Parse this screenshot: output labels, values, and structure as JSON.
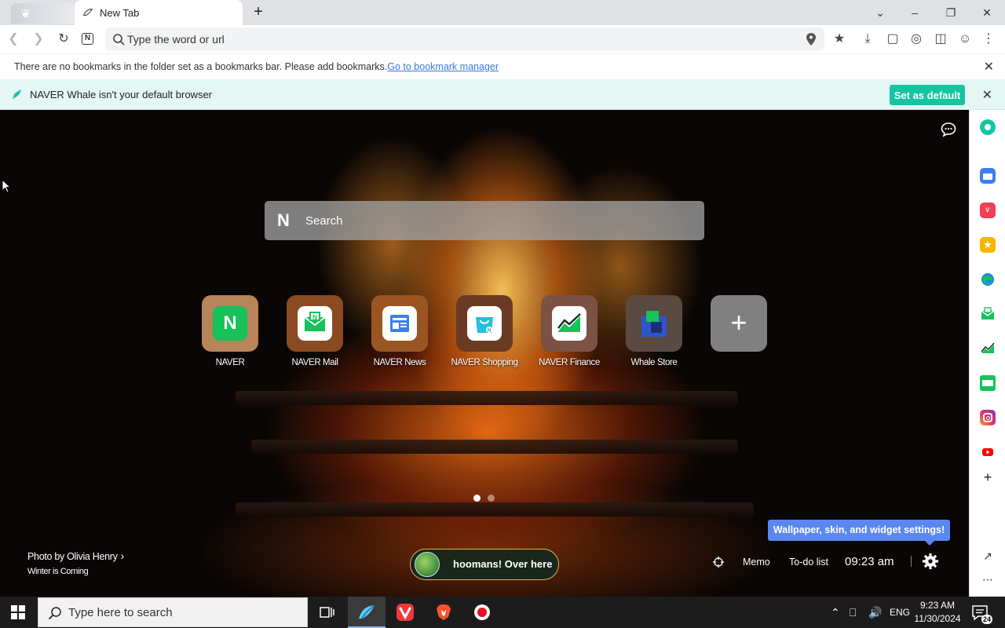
{
  "browser": {
    "tabs": [
      {
        "title": "New Tab",
        "active": true
      }
    ],
    "omnibox_placeholder": "Type the word or url",
    "nav_badge": "N",
    "bookmark_notice": {
      "text": "There are no bookmarks in the folder set as a bookmarks bar. Please add bookmarks.",
      "link": "Go to bookmark manager"
    },
    "infobar": {
      "text": "NAVER Whale isn't your default browser",
      "button": "Set as default"
    }
  },
  "ntp": {
    "search_logo": "N",
    "search_placeholder": "Search",
    "tiles": [
      {
        "label": "NAVER",
        "icon": "naver-icon",
        "bg": "#b8845a",
        "inner": "#16c25a"
      },
      {
        "label": "NAVER Mail",
        "icon": "naver-mail-icon",
        "bg": "#8a4a22",
        "inner": "#ffffff"
      },
      {
        "label": "NAVER News",
        "icon": "naver-news-icon",
        "bg": "#9a5523",
        "inner": "#ffffff"
      },
      {
        "label": "NAVER Shopping",
        "icon": "naver-shopping-icon",
        "bg": "#6a3b22",
        "inner": "#ffffff"
      },
      {
        "label": "NAVER Finance",
        "icon": "naver-finance-icon",
        "bg": "#7b5243",
        "inner": "#ffffff"
      },
      {
        "label": "Whale Store",
        "icon": "whale-store-icon",
        "bg": "#5b4a42",
        "inner": "#2f56c8"
      }
    ],
    "photo_credit": {
      "name": "Photo by Olivia Henry",
      "title": "Winter is Coming"
    },
    "hoomans": "hoomans! Over here",
    "widget_tooltip": "Wallpaper, skin, and widget settings!",
    "memo": "Memo",
    "todo": "To-do list",
    "clock": "09:23 am"
  },
  "sidebar_items": [
    "green-dot-icon",
    "calendar-icon",
    "pocket-icon",
    "star-icon",
    "edge-icon",
    "naver-mail-icon",
    "finance-icon",
    "webtoon-icon",
    "instagram-icon",
    "youtube-icon",
    "add-icon"
  ],
  "taskbar": {
    "search_placeholder": "Type here to search",
    "lang": "ENG",
    "time": "9:23 AM",
    "date": "11/30/2024",
    "notification_count": "24"
  },
  "colors": {
    "accent": "#16c5a0",
    "tooltip": "#5a88f0",
    "infobar_bg": "#e4f7f4"
  }
}
